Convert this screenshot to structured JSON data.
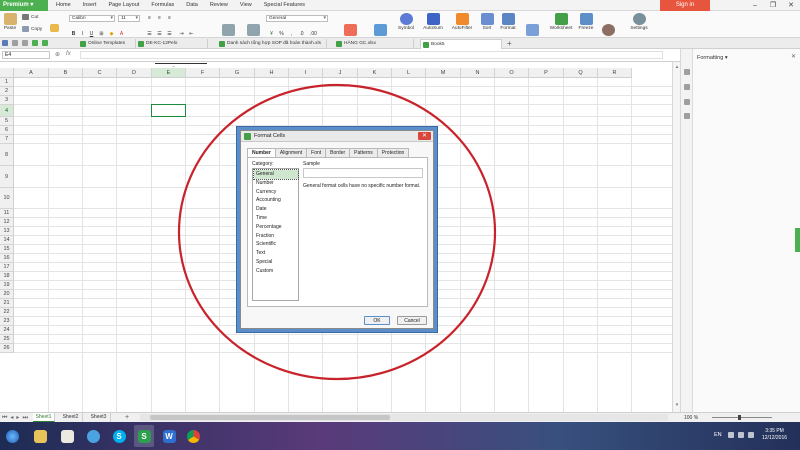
{
  "titlebar": {
    "app_label": "Premium",
    "tabs": [
      "Home",
      "Insert",
      "Page Layout",
      "Formulas",
      "Data",
      "Review",
      "View",
      "Special Features"
    ],
    "active_tab": "Home",
    "signin_label": "Sign in"
  },
  "ribbon": {
    "cut": "Cut",
    "copy": "Copy",
    "paste": "Paste",
    "format_painter": "Format\nPainter",
    "font_name": "Calibri",
    "font_size": "11",
    "merge_center": "Merge and\nCenter",
    "wrap_text": "Wrap\nText",
    "number_format": "General",
    "conditional_formatting": "Conditional\nFormatting",
    "format_as_table": "Format as\nTable",
    "symbol": "Symbol",
    "autosum": "AutoSum",
    "autofilter": "AutoFilter",
    "sort": "Sort",
    "format": "Format",
    "rows_columns": "Rows and\nColumns",
    "worksheet": "Worksheet",
    "freeze": "Freeze",
    "find_replace": "Find and\nReplace",
    "settings": "Settings"
  },
  "doc_tabs": {
    "items": [
      {
        "label": "Online Templates"
      },
      {
        "label": "DE-KC-12Pelo"
      },
      {
        "label": "Danh sách tổng hợp SOP đã hoàn thành.xls"
      },
      {
        "label": "HÀNG GC.xlsx"
      },
      {
        "label": "Book5"
      }
    ],
    "active_index": 4
  },
  "formula_bar": {
    "name_box": "E4",
    "fx": "fx"
  },
  "grid": {
    "columns": [
      "A",
      "B",
      "C",
      "D",
      "E",
      "F",
      "G",
      "H",
      "I",
      "J",
      "K",
      "L",
      "M",
      "N",
      "O",
      "P",
      "Q",
      "R"
    ],
    "rows": [
      "1",
      "2",
      "3",
      "4",
      "5",
      "6",
      "7",
      "8",
      "9",
      "10",
      "11",
      "12",
      "13",
      "14",
      "15",
      "16",
      "17",
      "18",
      "19",
      "20",
      "21",
      "22",
      "23",
      "24",
      "25",
      "26"
    ],
    "selected_cell": "E4",
    "selected_col": "E",
    "selected_row": "4"
  },
  "right_panel": {
    "title": "Formatting"
  },
  "sheets": {
    "items": [
      "Sheet1",
      "Sheet2",
      "Sheet3"
    ],
    "active": "Sheet1"
  },
  "status": {
    "zoom": "100 %"
  },
  "dialog": {
    "title": "Format Cells",
    "tabs": [
      "Number",
      "Alignment",
      "Font",
      "Border",
      "Patterns",
      "Protection"
    ],
    "active_tab": "Number",
    "category_label": "Category:",
    "categories": [
      "General",
      "Number",
      "Currency",
      "Accounting",
      "Date",
      "Time",
      "Percentage",
      "Fraction",
      "Scientific",
      "Text",
      "Special",
      "Custom"
    ],
    "selected_category": "General",
    "sample_label": "Sample",
    "description": "General format cells have no specific number format.",
    "ok_label": "OK",
    "cancel_label": "Cancel"
  },
  "taskbar": {
    "language": "EN",
    "time": "3:35 PM",
    "date": "12/12/2016"
  },
  "colors": {
    "accent": "#4caf50",
    "annotation": "#c8232b",
    "signin": "#e8553e"
  }
}
